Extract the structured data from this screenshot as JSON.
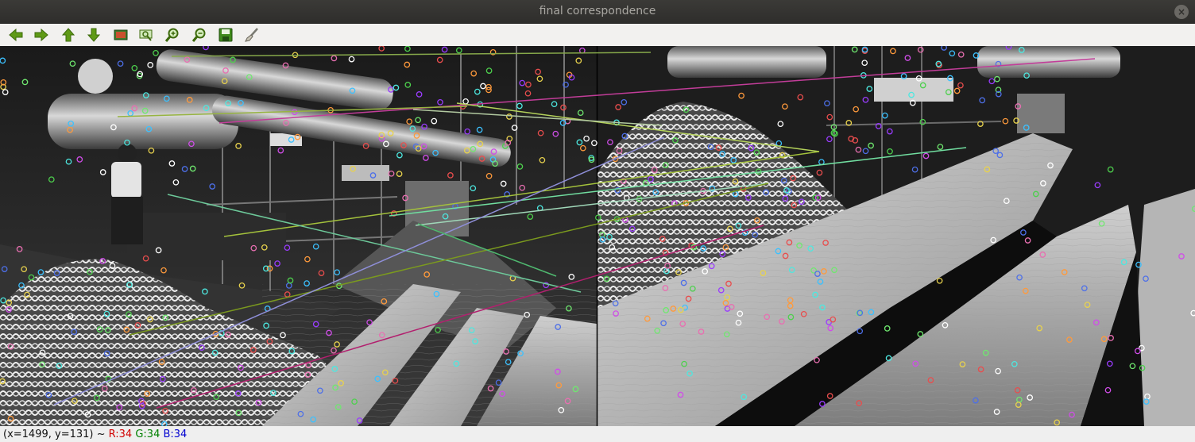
{
  "window": {
    "title": "final correspondence"
  },
  "toolbar": {
    "buttons": [
      {
        "name": "pan-left",
        "icon": "arrow-left-icon"
      },
      {
        "name": "pan-right",
        "icon": "arrow-right-icon"
      },
      {
        "name": "pan-up",
        "icon": "arrow-up-icon"
      },
      {
        "name": "pan-down",
        "icon": "arrow-down-icon"
      },
      {
        "name": "zoom-fit",
        "icon": "image-icon"
      },
      {
        "name": "zoom-original",
        "icon": "zoom-rect-icon"
      },
      {
        "name": "zoom-in",
        "icon": "zoom-in-icon"
      },
      {
        "name": "zoom-out",
        "icon": "zoom-out-icon"
      },
      {
        "name": "save",
        "icon": "save-icon"
      },
      {
        "name": "properties",
        "icon": "brush-icon"
      }
    ]
  },
  "status": {
    "coords": "(x=1499, y=131) ~ ",
    "r": "R:34",
    "g": "G:34",
    "b": "B:34"
  },
  "colors": {
    "accent_green": "#6a9b1f",
    "status_r": "#d00000",
    "status_g": "#008000",
    "status_b": "#0000d0"
  }
}
